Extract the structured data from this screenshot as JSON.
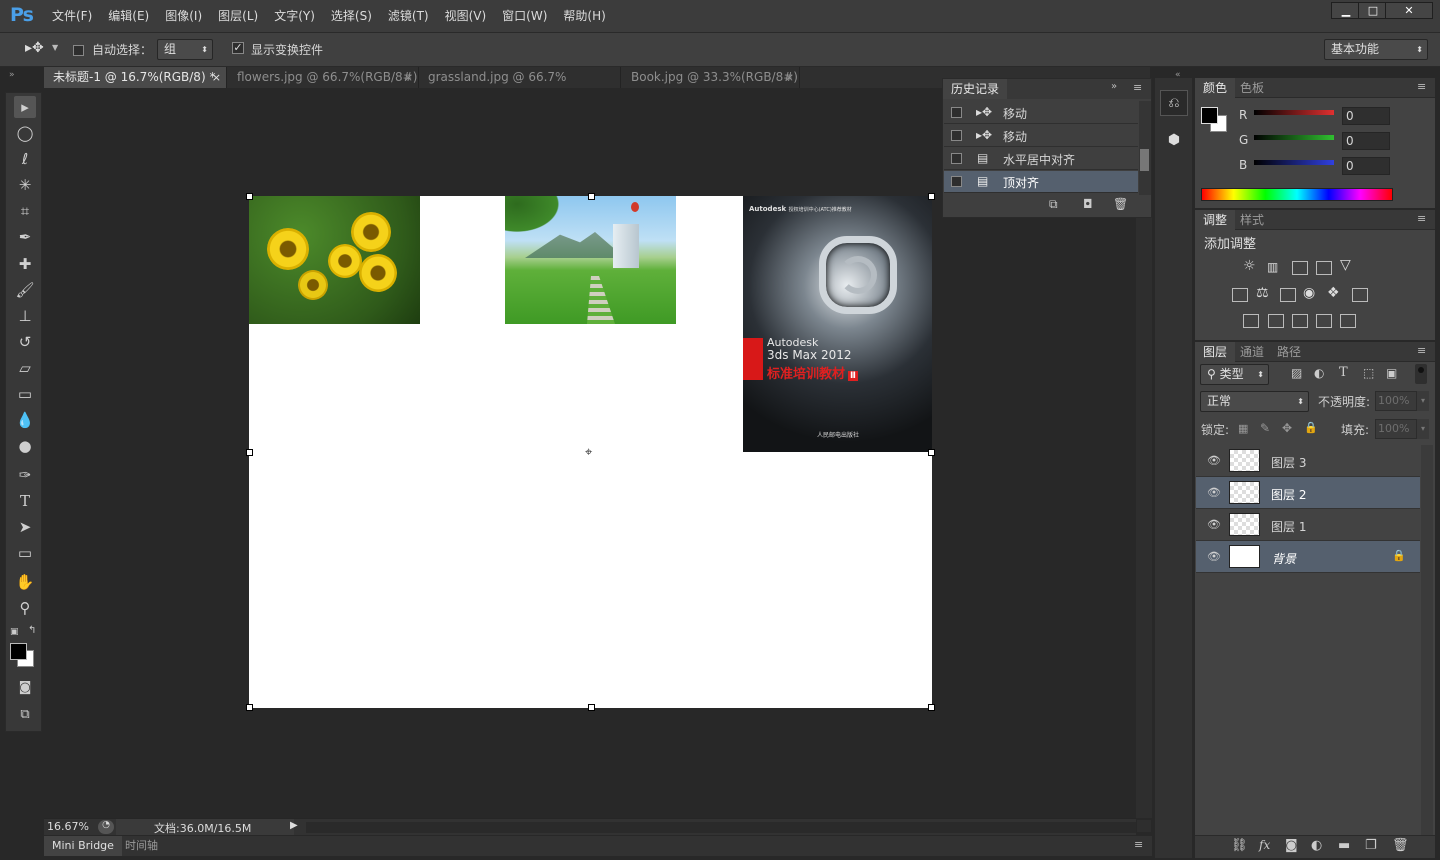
{
  "app": {
    "logo": "Ps"
  },
  "menu": [
    "文件(F)",
    "编辑(E)",
    "图像(I)",
    "图层(L)",
    "文字(Y)",
    "选择(S)",
    "滤镜(T)",
    "视图(V)",
    "窗口(W)",
    "帮助(H)"
  ],
  "window_controls": {
    "minimize": "▁",
    "maximize": "□",
    "close": "✕"
  },
  "options": {
    "auto_select_label": "自动选择：",
    "auto_select_value": "组",
    "show_transform_label": "显示变换控件",
    "workspace": "基本功能"
  },
  "tabs": [
    {
      "label": "未标题-1 @ 16.7%(RGB/8) *",
      "close": "×"
    },
    {
      "label": "flowers.jpg @ 66.7%(RGB/8#)",
      "close": "×"
    },
    {
      "label": "grassland.jpg @ 66.7%(RGB/8#)",
      "close": "×"
    },
    {
      "label": "Book.jpg @ 33.3%(RGB/8#)",
      "close": "×"
    }
  ],
  "canvas": {
    "book": {
      "header": "Autodesk",
      "header_small": "授权培训中心(ATC)推荐教材",
      "line1": "Autodesk",
      "line2": "3ds Max 2012",
      "cn_title": "标准培训教材",
      "roman": "Ⅱ",
      "publisher": "人民邮电出版社"
    }
  },
  "history": {
    "title": "历史记录",
    "items": [
      {
        "label": "移动",
        "icon": "move-tool-icon"
      },
      {
        "label": "移动",
        "icon": "move-tool-icon"
      },
      {
        "label": "水平居中对齐",
        "icon": "document-icon"
      },
      {
        "label": "顶对齐",
        "icon": "document-icon"
      }
    ]
  },
  "color_panel": {
    "tabs": [
      "颜色",
      "色板"
    ],
    "channels": [
      {
        "name": "R",
        "value": "0",
        "color": "#e03030"
      },
      {
        "name": "G",
        "value": "0",
        "color": "#30c030"
      },
      {
        "name": "B",
        "value": "0",
        "color": "#3040e0"
      }
    ]
  },
  "adjust_panel": {
    "tabs": [
      "调整",
      "样式"
    ],
    "title": "添加调整"
  },
  "layers_panel": {
    "tabs": [
      "图层",
      "通道",
      "路径"
    ],
    "filter_label": "类型",
    "blend_mode": "正常",
    "opacity_label": "不透明度:",
    "opacity_value": "100%",
    "lock_label": "锁定:",
    "fill_label": "填充:",
    "fill_value": "100%",
    "layers": [
      {
        "name": "图层 3",
        "selected": false
      },
      {
        "name": "图层 2",
        "selected": true
      },
      {
        "name": "图层 1",
        "selected": false
      },
      {
        "name": "背景",
        "selected": true
      }
    ]
  },
  "status": {
    "zoom": "16.67%",
    "doc": "文档:36.0M/16.5M"
  },
  "bottom_tabs": [
    "Mini Bridge",
    "时间轴"
  ]
}
